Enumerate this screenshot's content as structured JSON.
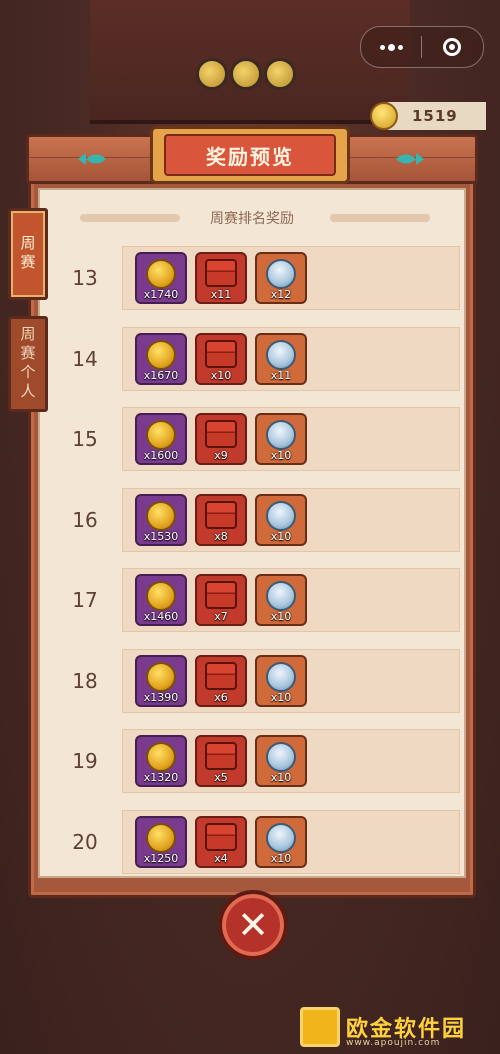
{
  "header": {
    "coin_balance": "1519"
  },
  "panel": {
    "title": "奖励预览",
    "subtitle": "周赛排名奖励"
  },
  "tabs": [
    {
      "label": "周赛",
      "active": true
    },
    {
      "label": "周赛个人",
      "active": false
    }
  ],
  "rows": [
    {
      "rank": "13",
      "coin": "x1740",
      "chest": "x11",
      "bowl": "x12"
    },
    {
      "rank": "14",
      "coin": "x1670",
      "chest": "x10",
      "bowl": "x11"
    },
    {
      "rank": "15",
      "coin": "x1600",
      "chest": "x9",
      "bowl": "x10"
    },
    {
      "rank": "16",
      "coin": "x1530",
      "chest": "x8",
      "bowl": "x10"
    },
    {
      "rank": "17",
      "coin": "x1460",
      "chest": "x7",
      "bowl": "x10"
    },
    {
      "rank": "18",
      "coin": "x1390",
      "chest": "x6",
      "bowl": "x10"
    },
    {
      "rank": "19",
      "coin": "x1320",
      "chest": "x5",
      "bowl": "x10"
    },
    {
      "rank": "20",
      "coin": "x1250",
      "chest": "x4",
      "bowl": "x10"
    }
  ],
  "watermark": {
    "text": "欧金软件园",
    "url": "www.apoujin.com"
  },
  "icons": {
    "coin": "coin-icon",
    "chest": "chest-icon",
    "bowl": "bowl-icon",
    "close": "close-icon"
  }
}
